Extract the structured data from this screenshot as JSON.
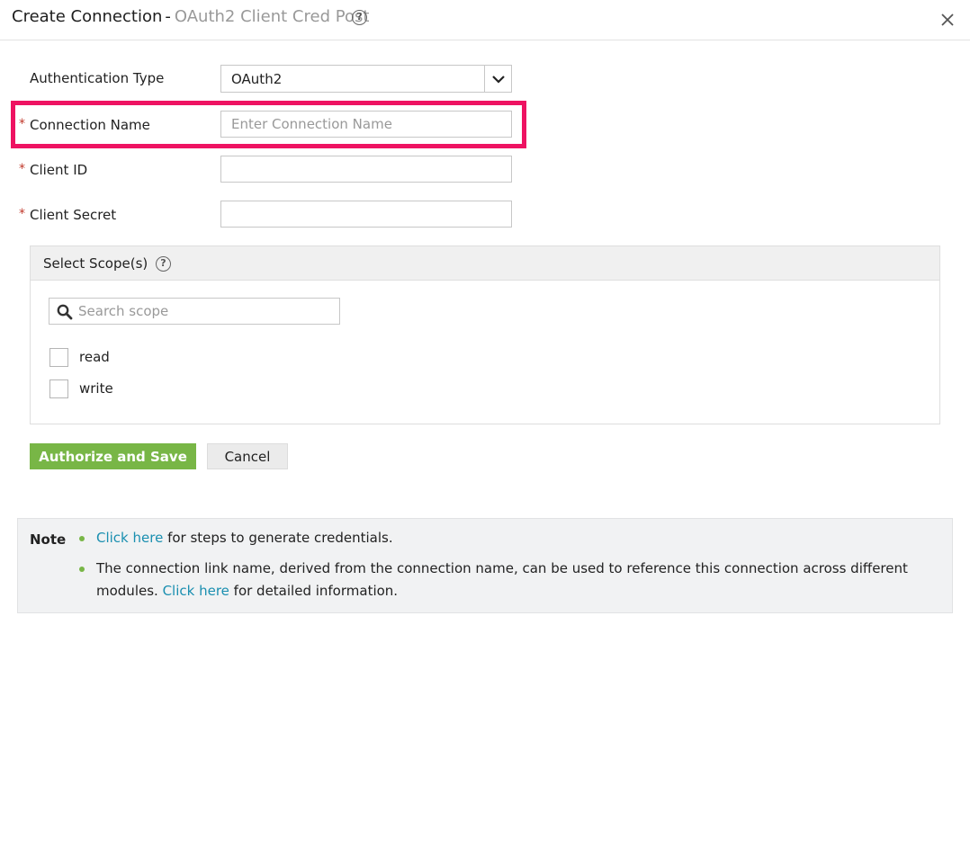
{
  "header": {
    "title": "Create Connection",
    "separator": "-",
    "subtitle": "OAuth2 Client Cred Post",
    "help_glyph": "?"
  },
  "form": {
    "auth_type_label": "Authentication Type",
    "auth_type_value": "OAuth2",
    "required_marker": "*",
    "connection_name_label": "Connection Name",
    "connection_name_placeholder": "Enter Connection Name",
    "connection_name_value": "",
    "client_id_label": "Client ID",
    "client_id_value": "",
    "client_secret_label": "Client Secret",
    "client_secret_value": ""
  },
  "scopes": {
    "title": "Select Scope(s)",
    "help_glyph": "?",
    "search_placeholder": "Search scope",
    "items": [
      {
        "label": "read",
        "checked": false
      },
      {
        "label": "write",
        "checked": false
      }
    ]
  },
  "actions": {
    "authorize_label": "Authorize and Save",
    "cancel_label": "Cancel"
  },
  "note": {
    "title": "Note",
    "line1_link": "Click here",
    "line1_text": " for steps to generate credentials.",
    "line2_text": "The connection link name, derived from the connection name, can be used to reference this connection across different",
    "line3_prefix": "modules. ",
    "line3_link": "Click here",
    "line3_suffix": " for detailed information."
  },
  "colors": {
    "highlight": "#ee1362",
    "primary_button": "#78b646",
    "link": "#1a8fb0",
    "required": "#c0392b"
  },
  "icons": [
    "help-icon",
    "close-icon",
    "chevron-down-icon",
    "search-icon"
  ]
}
